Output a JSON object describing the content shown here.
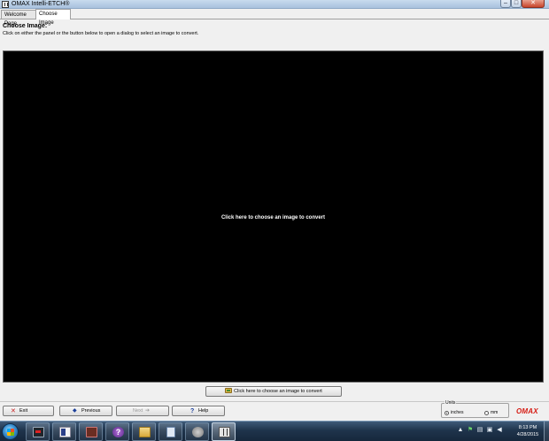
{
  "window": {
    "title": "OMAX Intelli-ETCH®",
    "minimize_glyph": "–",
    "maximize_glyph": "□",
    "close_glyph": "✕"
  },
  "tabs": [
    {
      "label": "Welcome Page",
      "active": false
    },
    {
      "label": "Choose Image",
      "active": true
    }
  ],
  "page": {
    "title": "Choose Image:",
    "instructions": "Click on either the panel or the button below to open a dialog to select an image to convert."
  },
  "image_panel": {
    "prompt": "Click here to choose an image to convert",
    "background": "#000000"
  },
  "choose_button": {
    "label": "Click here to choose an image to convert",
    "icon": "folder-open-icon"
  },
  "nav": {
    "exit_label": "Exit",
    "exit_icon_glyph": "✕",
    "previous_label": "Previous",
    "previous_icon_glyph": "◆",
    "next_label": "Next",
    "next_icon_glyph": "➔",
    "next_enabled": false,
    "help_label": "Help",
    "help_icon_glyph": "?"
  },
  "units": {
    "legend": "Units",
    "options": [
      {
        "label": "inches",
        "selected": true
      },
      {
        "label": "mm",
        "selected": false
      }
    ]
  },
  "brand": {
    "logo_text": "OMAX",
    "logo_color": "#d61a12"
  },
  "taskbar": {
    "clock_time": "8:13 PM",
    "clock_date": "4/28/2015",
    "tray_glyphs": [
      "▲",
      "⚑",
      "▤",
      "▣",
      "◀"
    ],
    "apps": [
      {
        "name": "terminal-app",
        "active": false
      },
      {
        "name": "document-app",
        "active": false
      },
      {
        "name": "media-app",
        "active": false
      },
      {
        "name": "help-app",
        "active": false,
        "glyph": "?"
      },
      {
        "name": "file-explorer-app",
        "active": false
      },
      {
        "name": "notes-app",
        "active": false
      },
      {
        "name": "settings-app",
        "active": false
      },
      {
        "name": "intelli-etch-app",
        "active": true
      }
    ]
  }
}
